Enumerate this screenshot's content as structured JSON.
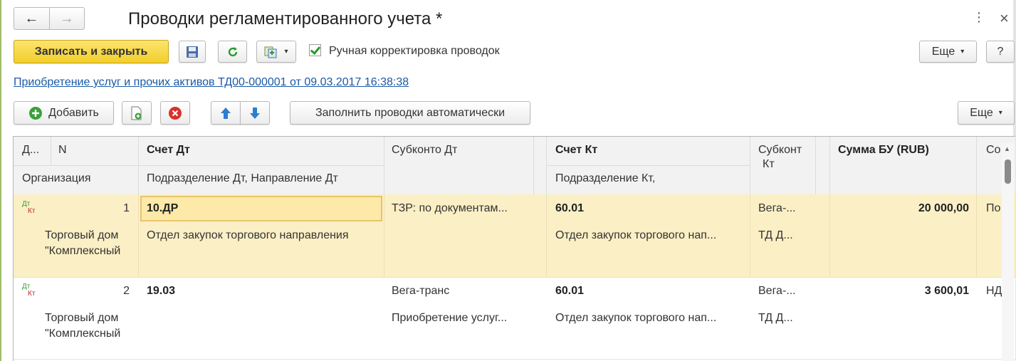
{
  "window": {
    "title": "Проводки регламентированного учета *",
    "more_icon": "⋮",
    "close_icon": "×"
  },
  "nav": {
    "back": "←",
    "forward": "→"
  },
  "toolbar": {
    "save_close_label": "Записать и закрыть",
    "refresh_icon": "C",
    "manual_correction_label": "Ручная корректировка проводок",
    "manual_correction_checked": true,
    "more_label": "Еще",
    "help_label": "?"
  },
  "document_link": "Приобретение услуг и прочих активов ТД00-000001 от 09.03.2017 16:38:38",
  "table_toolbar": {
    "add_label": "Добавить",
    "autofill_label": "Заполнить проводки автоматически",
    "more_label": "Еще"
  },
  "columns": {
    "d": "Д...",
    "n": "N",
    "schet_dt": "Счет Дт",
    "subkonto_dt": "Субконто Дт",
    "schet_kt": "Счет Кт",
    "subkonto_kt_1": "Субконт",
    "subkonto_kt_2": "Кт",
    "summa": "Сумма БУ (RUB)",
    "co": "Со",
    "org": "Организация",
    "podr_dt": "Подразделение Дт, Направление Дт",
    "podr_kt": "Подразделение Кт,"
  },
  "dtkt": {
    "dt": "Дт",
    "kt": "Кт"
  },
  "rows": [
    {
      "n": "1",
      "schet_dt": "10.ДР",
      "subkonto_dt": "ТЗР: по документам...",
      "schet_kt": "60.01",
      "subkonto_kt": "Вега-...",
      "summa": "20 000,00",
      "co": "По",
      "org_1": "Торговый дом",
      "org_2": "\"Комплексный",
      "podr_dt": "Отдел закупок торгового направления",
      "subkonto_dt_2": "",
      "podr_kt": "Отдел закупок торгового нап...",
      "subkonto_kt_2": "ТД Д..."
    },
    {
      "n": "2",
      "schet_dt": "19.03",
      "subkonto_dt": "Вега-транс",
      "schet_kt": "60.01",
      "subkonto_kt": "Вега-...",
      "summa": "3 600,01",
      "co": "НД",
      "org_1": "Торговый дом",
      "org_2": "\"Комплексный",
      "podr_dt": "",
      "subkonto_dt_2": "Приобретение услуг...",
      "podr_kt": "Отдел закупок торгового нап...",
      "subkonto_kt_2": "ТД Д..."
    }
  ],
  "colors": {
    "primary_button": "#f2cf2a",
    "selected_row": "#fbefc5",
    "link": "#1b5aa6"
  }
}
